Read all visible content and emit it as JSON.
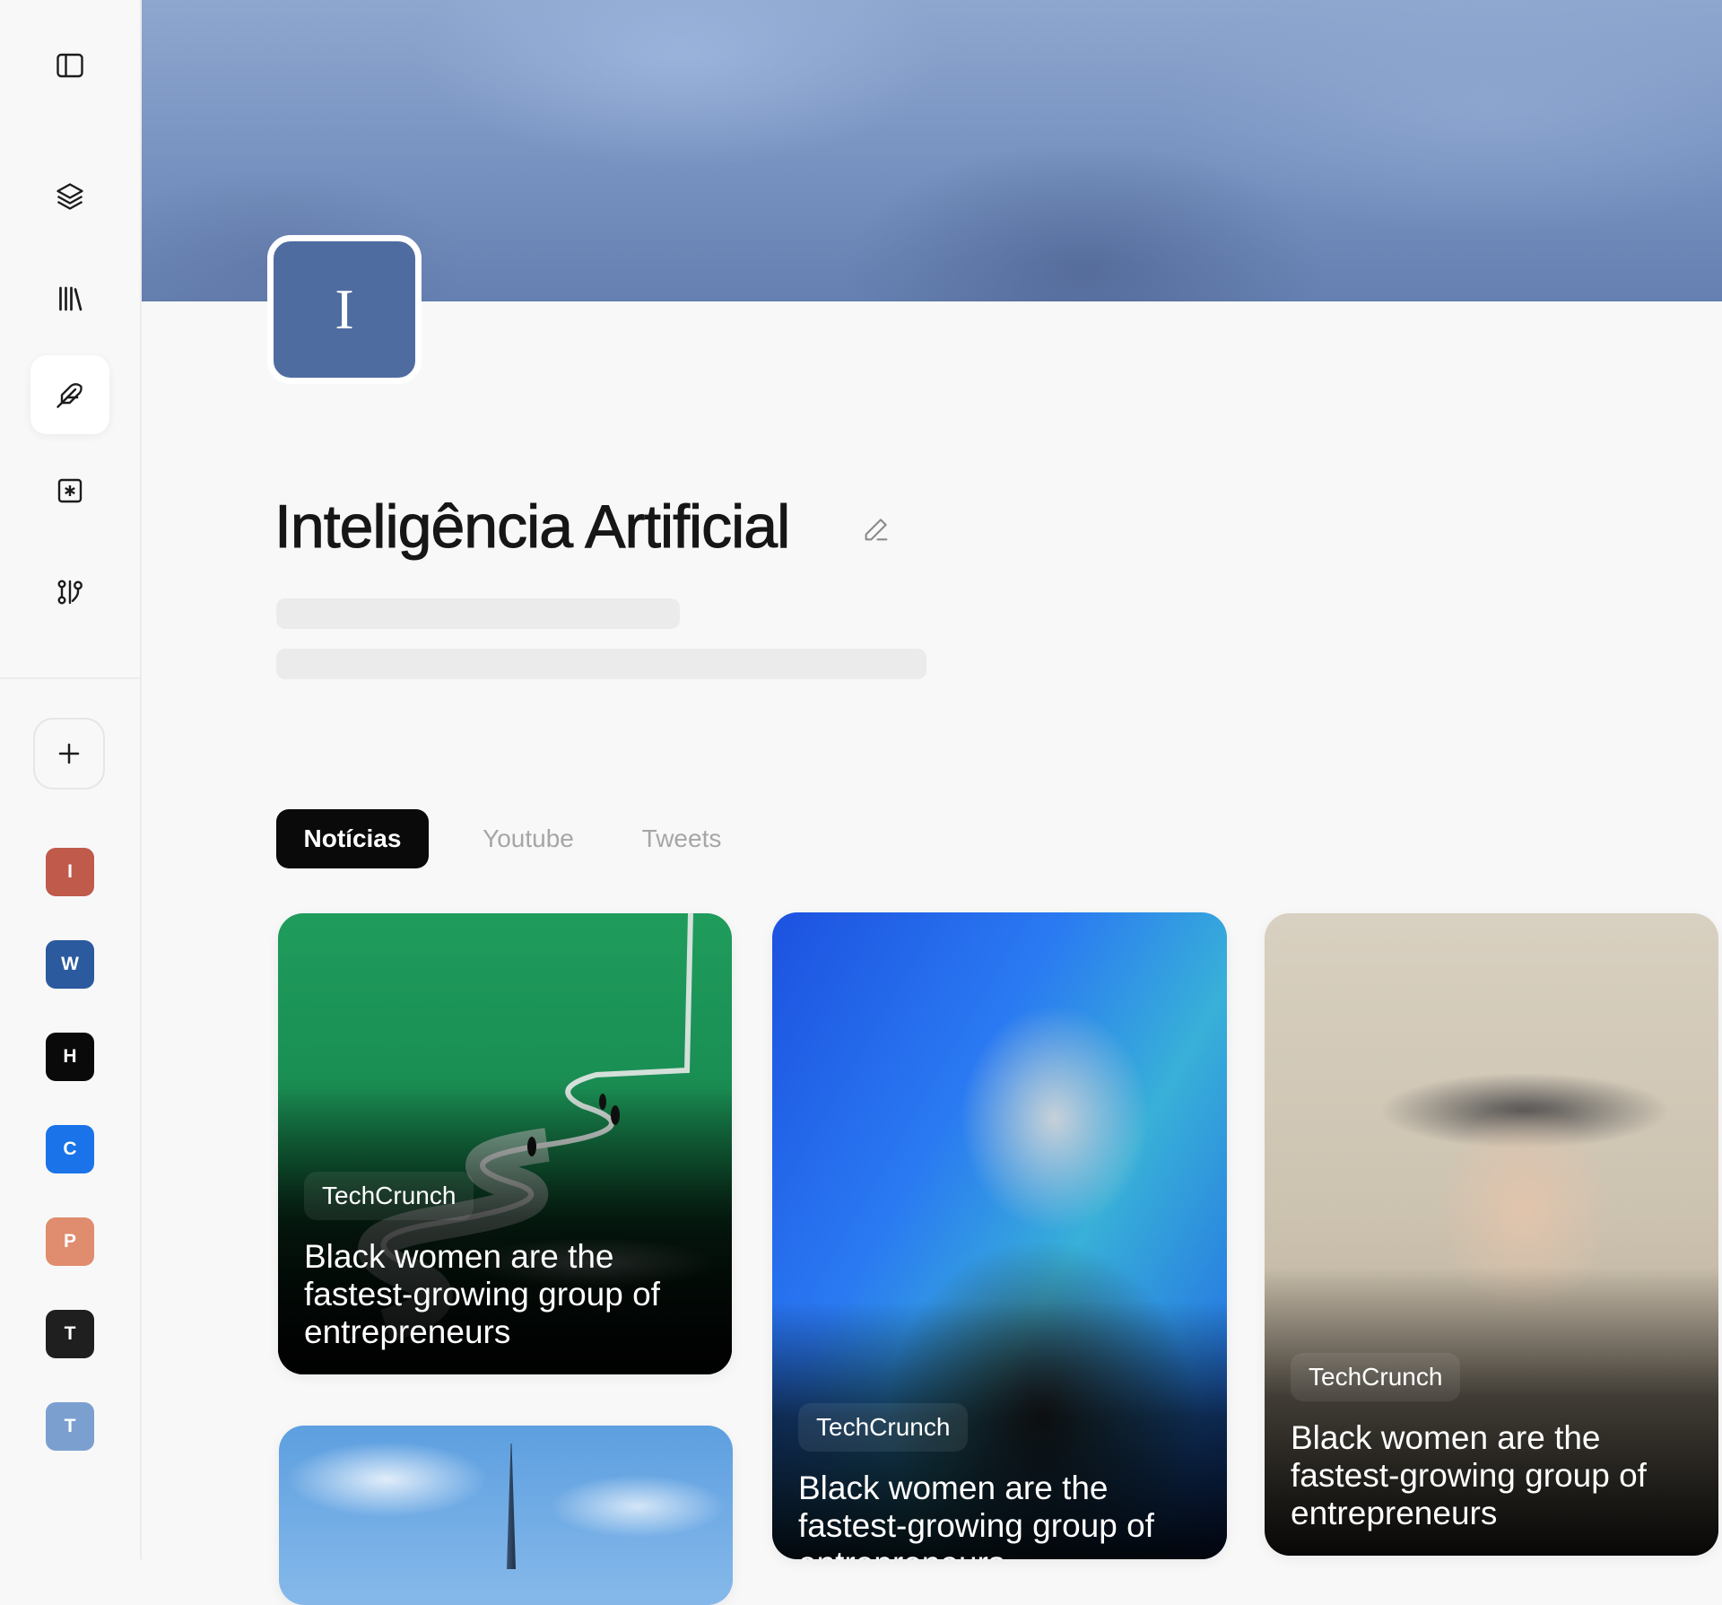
{
  "sidebar": {
    "nav": [
      {
        "icon": "sidebar-toggle-icon"
      },
      {
        "icon": "layers-icon"
      },
      {
        "icon": "library-icon"
      },
      {
        "icon": "feather-icon",
        "active": true
      },
      {
        "icon": "asterisk-box-icon"
      },
      {
        "icon": "flow-icon"
      }
    ],
    "add_icon": "plus-icon",
    "workspaces": [
      {
        "letter": "I",
        "color": "#c05a4a"
      },
      {
        "letter": "W",
        "color": "#2b5a9e"
      },
      {
        "letter": "H",
        "color": "#0a0a0a"
      },
      {
        "letter": "C",
        "color": "#1a73e8"
      },
      {
        "letter": "P",
        "color": "#e08c6e"
      },
      {
        "letter": "T",
        "color": "#1f1f1f"
      },
      {
        "letter": "T",
        "color": "#7ba0d0"
      }
    ]
  },
  "header": {
    "avatar_letter": "I",
    "avatar_color": "#4f6ca1",
    "banner_color": "#7b96c3",
    "title": "Inteligência Artificial",
    "edit_icon": "pencil-icon"
  },
  "tabs": [
    {
      "label": "Notícias",
      "active": true
    },
    {
      "label": "Youtube",
      "active": false
    },
    {
      "label": "Tweets",
      "active": false
    }
  ],
  "cards": [
    {
      "source": "TechCrunch",
      "title": "Black women are the fastest-growing group of entrepreneurs"
    },
    {
      "source": "TechCrunch",
      "title": "Black women are the fastest-growing group of entrepreneurs"
    },
    {
      "source": "TechCrunch",
      "title": "Black women are the fastest-growing group of entrepreneurs"
    }
  ]
}
